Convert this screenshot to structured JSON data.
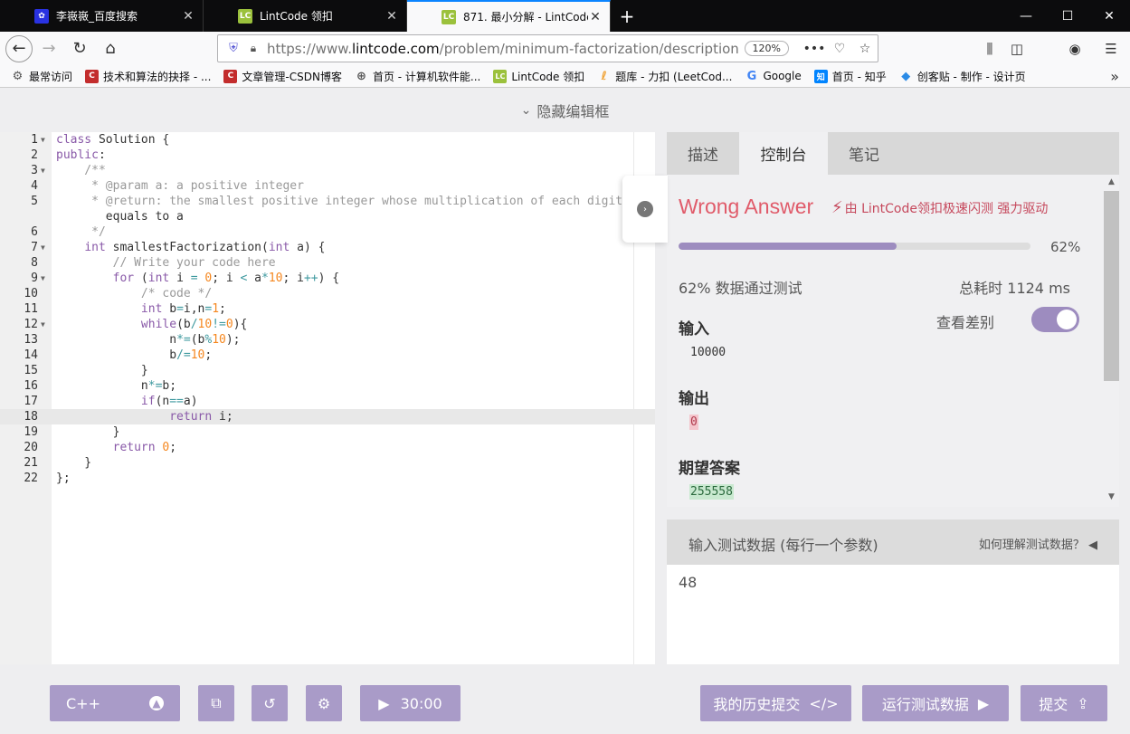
{
  "browser": {
    "tabs": [
      {
        "label": "李嶶嶶_百度搜索",
        "favicon": "paw-icon",
        "color": "#2932e1"
      },
      {
        "label": "LintCode 领扣",
        "favicon": "LC",
        "color": "#9bc13c"
      },
      {
        "label": "871. 最小分解 - LintCode",
        "favicon": "LC",
        "color": "#9bc13c"
      }
    ],
    "url_prefix": "https://www.",
    "url_domain": "lintcode.com",
    "url_path": "/problem/minimum-factorization/description",
    "zoom": "120%",
    "bookmarks": [
      {
        "label": "最常访问",
        "icon": "gear-icon",
        "color": "#555555"
      },
      {
        "label": "技术和算法的抉择 - ...",
        "icon": "C",
        "color": "#c32d2d"
      },
      {
        "label": "文章管理-CSDN博客",
        "icon": "C",
        "color": "#c32d2d"
      },
      {
        "label": "首页 - 计算机软件能...",
        "icon": "globe-icon",
        "color": "#555555"
      },
      {
        "label": "LintCode 领扣",
        "icon": "LC",
        "color": "#9bc13c"
      },
      {
        "label": "题库 - 力扣 (LeetCod...",
        "icon": "leetcode-icon",
        "color": "#f0a030"
      },
      {
        "label": "Google",
        "icon": "G",
        "color": "#4285f4"
      },
      {
        "label": "首页 - 知乎",
        "icon": "知",
        "color": "#0084ff"
      },
      {
        "label": "创客贴 - 制作 - 设计页",
        "icon": "drop-icon",
        "color": "#2b8be6"
      }
    ]
  },
  "editor_toggle": "隐藏编辑框",
  "code_lines": [
    "class Solution {",
    "public:",
    "    /**",
    "     * @param a: a positive integer",
    "     * @return: the smallest positive integer whose multiplication of each digit",
    "       equals to a",
    "     */",
    "    int smallestFactorization(int a) {",
    "        // Write your code here",
    "        for (int i = 0; i < a*10; i++) {",
    "            /* code */",
    "            int b=i,n=1;",
    "            while(b/10!=0){",
    "                n*=(b%10);",
    "                b/=10;",
    "            }",
    "            n*=b;",
    "            if(n==a)",
    "                return i;",
    "        }",
    "        return 0;",
    "    }",
    "};"
  ],
  "line_numbers": [
    "1",
    "2",
    "3",
    "4",
    "5",
    "",
    "6",
    "7",
    "8",
    "9",
    "10",
    "11",
    "12",
    "13",
    "14",
    "15",
    "16",
    "17",
    "18",
    "19",
    "20",
    "21",
    "22"
  ],
  "panel": {
    "tabs": [
      "描述",
      "控制台",
      "笔记"
    ],
    "active_tab": "控制台",
    "verdict": "Wrong Answer",
    "powered_by": "由 LintCode领扣极速闪测 强力驱动",
    "progress": 62,
    "progress_label": "62%",
    "pass_text": "62% 数据通过测试",
    "time_text": "总耗时 1124 ms",
    "diff_label": "查看差别",
    "input_label": "输入",
    "input_value": "10000",
    "output_label": "输出",
    "output_value": "0",
    "expected_label": "期望答案",
    "expected_value": "255558",
    "test_header": "输入测试数据 (每行一个参数)",
    "test_help": "如何理解测试数据？",
    "test_value": "48"
  },
  "bottom": {
    "language": "C++",
    "timer": "30:00",
    "history": "我的历史提交",
    "run": "运行测试数据",
    "submit": "提交"
  }
}
